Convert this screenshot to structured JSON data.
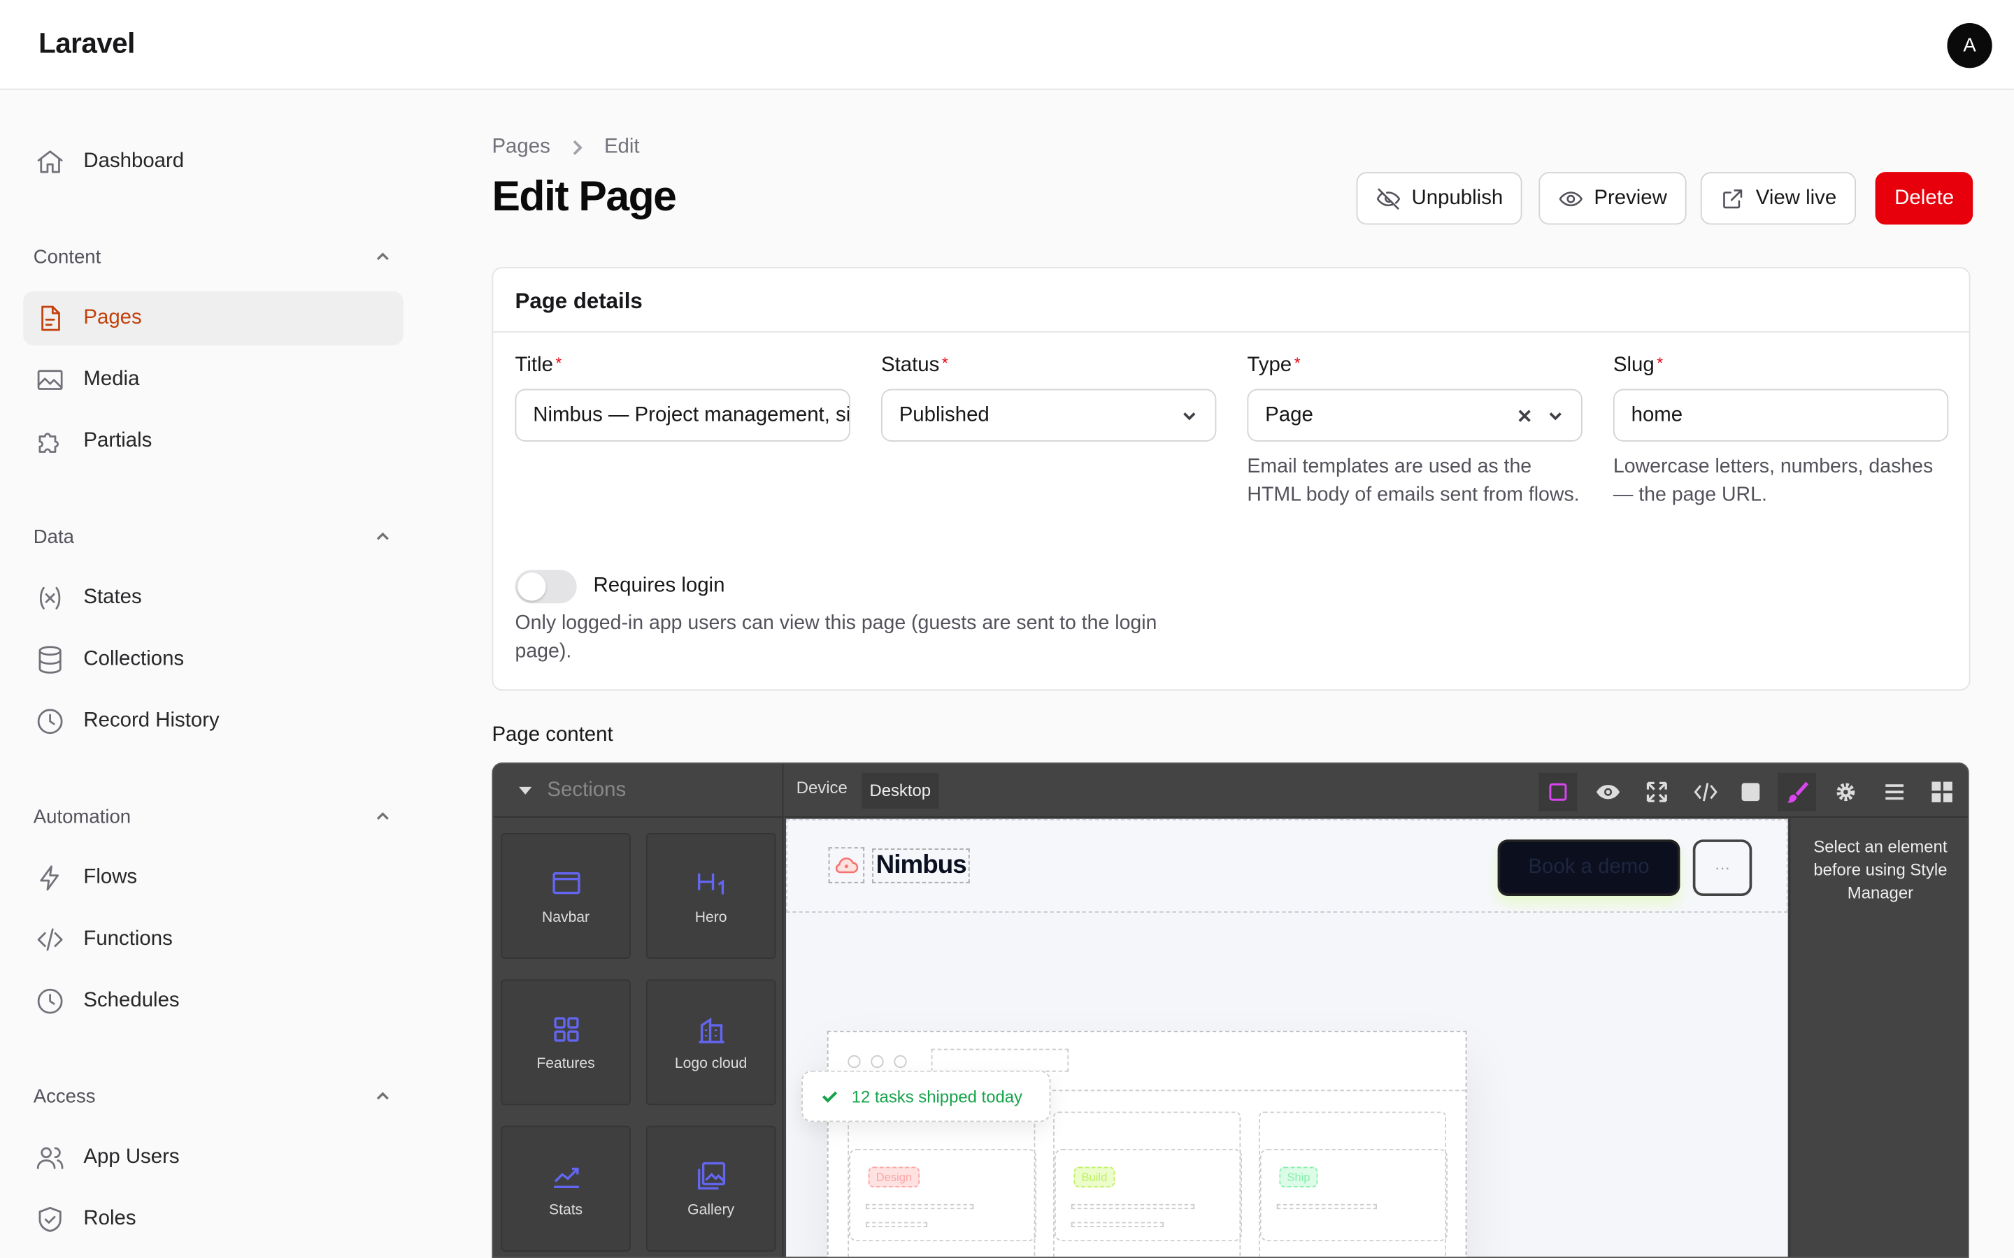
{
  "app": {
    "brand": "Laravel",
    "avatar_initial": "A"
  },
  "sidebar": {
    "dashboard": "Dashboard",
    "groups": [
      {
        "title": "Content",
        "items": [
          "Pages",
          "Media",
          "Partials"
        ]
      },
      {
        "title": "Data",
        "items": [
          "States",
          "Collections",
          "Record History"
        ]
      },
      {
        "title": "Automation",
        "items": [
          "Flows",
          "Functions",
          "Schedules"
        ]
      },
      {
        "title": "Access",
        "items": [
          "App Users",
          "Roles"
        ]
      }
    ],
    "active_item": "Pages"
  },
  "breadcrumb": {
    "root": "Pages",
    "current": "Edit"
  },
  "page": {
    "title": "Edit Page"
  },
  "actions": {
    "unpublish": "Unpublish",
    "preview": "Preview",
    "view_live": "View live",
    "delete": "Delete"
  },
  "details": {
    "heading": "Page details",
    "title": {
      "label": "Title",
      "value": "Nimbus — Project management, simplified"
    },
    "status": {
      "label": "Status",
      "value": "Published"
    },
    "type": {
      "label": "Type",
      "value": "Page",
      "help": "Email templates are used as the HTML body of emails sent from flows."
    },
    "slug": {
      "label": "Slug",
      "value": "home",
      "help": "Lowercase letters, numbers, dashes — the page URL."
    },
    "requires_login": {
      "label": "Requires login",
      "enabled": false,
      "help": "Only logged-in app users can view this page (guests are sent to the login page)."
    }
  },
  "content": {
    "label": "Page content",
    "editor": {
      "blocks_title": "Sections",
      "blocks": [
        "Navbar",
        "Hero",
        "Features",
        "Logo cloud",
        "Stats",
        "Gallery"
      ],
      "device_label": "Device",
      "device_value": "Desktop",
      "style_manager_msg": "Select an element before using Style Manager",
      "canvas": {
        "logo_text": "Nimbus",
        "cta": "Book a demo",
        "toast": "12 tasks shipped today",
        "columns": [
          "Design",
          "Build",
          "Ship"
        ]
      }
    }
  },
  "colors": {
    "accent": "#c2410c",
    "danger": "#e7000b",
    "block_icon": "#6366f1"
  }
}
